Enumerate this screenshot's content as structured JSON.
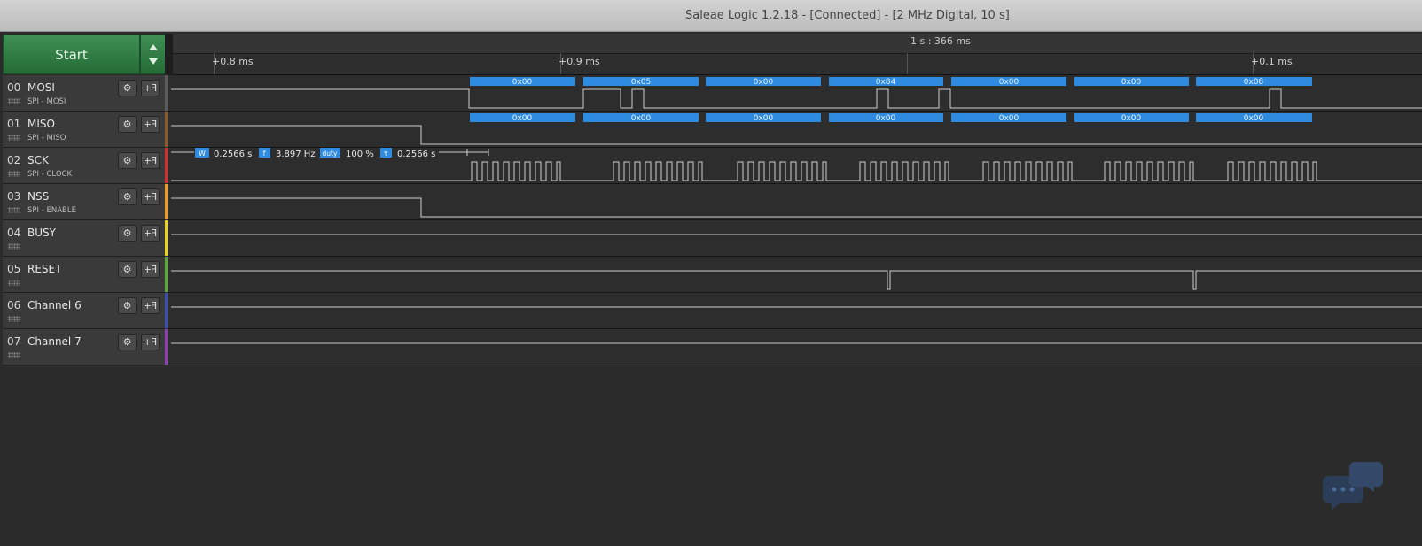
{
  "window": {
    "title": "Saleae Logic 1.2.18 - [Connected] - [2 MHz Digital, 10 s]"
  },
  "toolbar": {
    "start_label": "Start"
  },
  "timeline": {
    "marker": "1 s : 366 ms",
    "ticks": [
      "+0.8 ms",
      "+0.9 ms",
      "+0.1 ms"
    ]
  },
  "channels": [
    {
      "num": "00",
      "name": "MOSI",
      "sub": "SPI - MOSI",
      "color": "#5b5b5b"
    },
    {
      "num": "01",
      "name": "MISO",
      "sub": "SPI - MISO",
      "color": "#8a5a2b"
    },
    {
      "num": "02",
      "name": "SCK",
      "sub": "SPI - CLOCK",
      "color": "#d32f2f"
    },
    {
      "num": "03",
      "name": "NSS",
      "sub": "SPI - ENABLE",
      "color": "#f09a1a"
    },
    {
      "num": "04",
      "name": "BUSY",
      "sub": "",
      "color": "#e8d21c"
    },
    {
      "num": "05",
      "name": "RESET",
      "sub": "",
      "color": "#5aa935"
    },
    {
      "num": "06",
      "name": "Channel 6",
      "sub": "",
      "color": "#3a4fb6"
    },
    {
      "num": "07",
      "name": "Channel 7",
      "sub": "",
      "color": "#8e3fb4"
    }
  ],
  "mosi_bytes": [
    "0x00",
    "0x05",
    "0x00",
    "0x84",
    "0x00",
    "0x00",
    "0x08"
  ],
  "miso_bytes": [
    "0x00",
    "0x00",
    "0x00",
    "0x00",
    "0x00",
    "0x00",
    "0x00"
  ],
  "measurements": {
    "w_badge": "W",
    "w_value": "0.2566 s",
    "f_badge": "f",
    "f_value": "3.897 Hz",
    "duty_badge": "duty",
    "duty_value": "100 %",
    "tau_badge": "τ",
    "tau_value": "0.2566 s"
  },
  "colors": {
    "decode_bar": "#2e8be0",
    "trace": "#d0d0d0",
    "start_green": "#2f7d42"
  }
}
